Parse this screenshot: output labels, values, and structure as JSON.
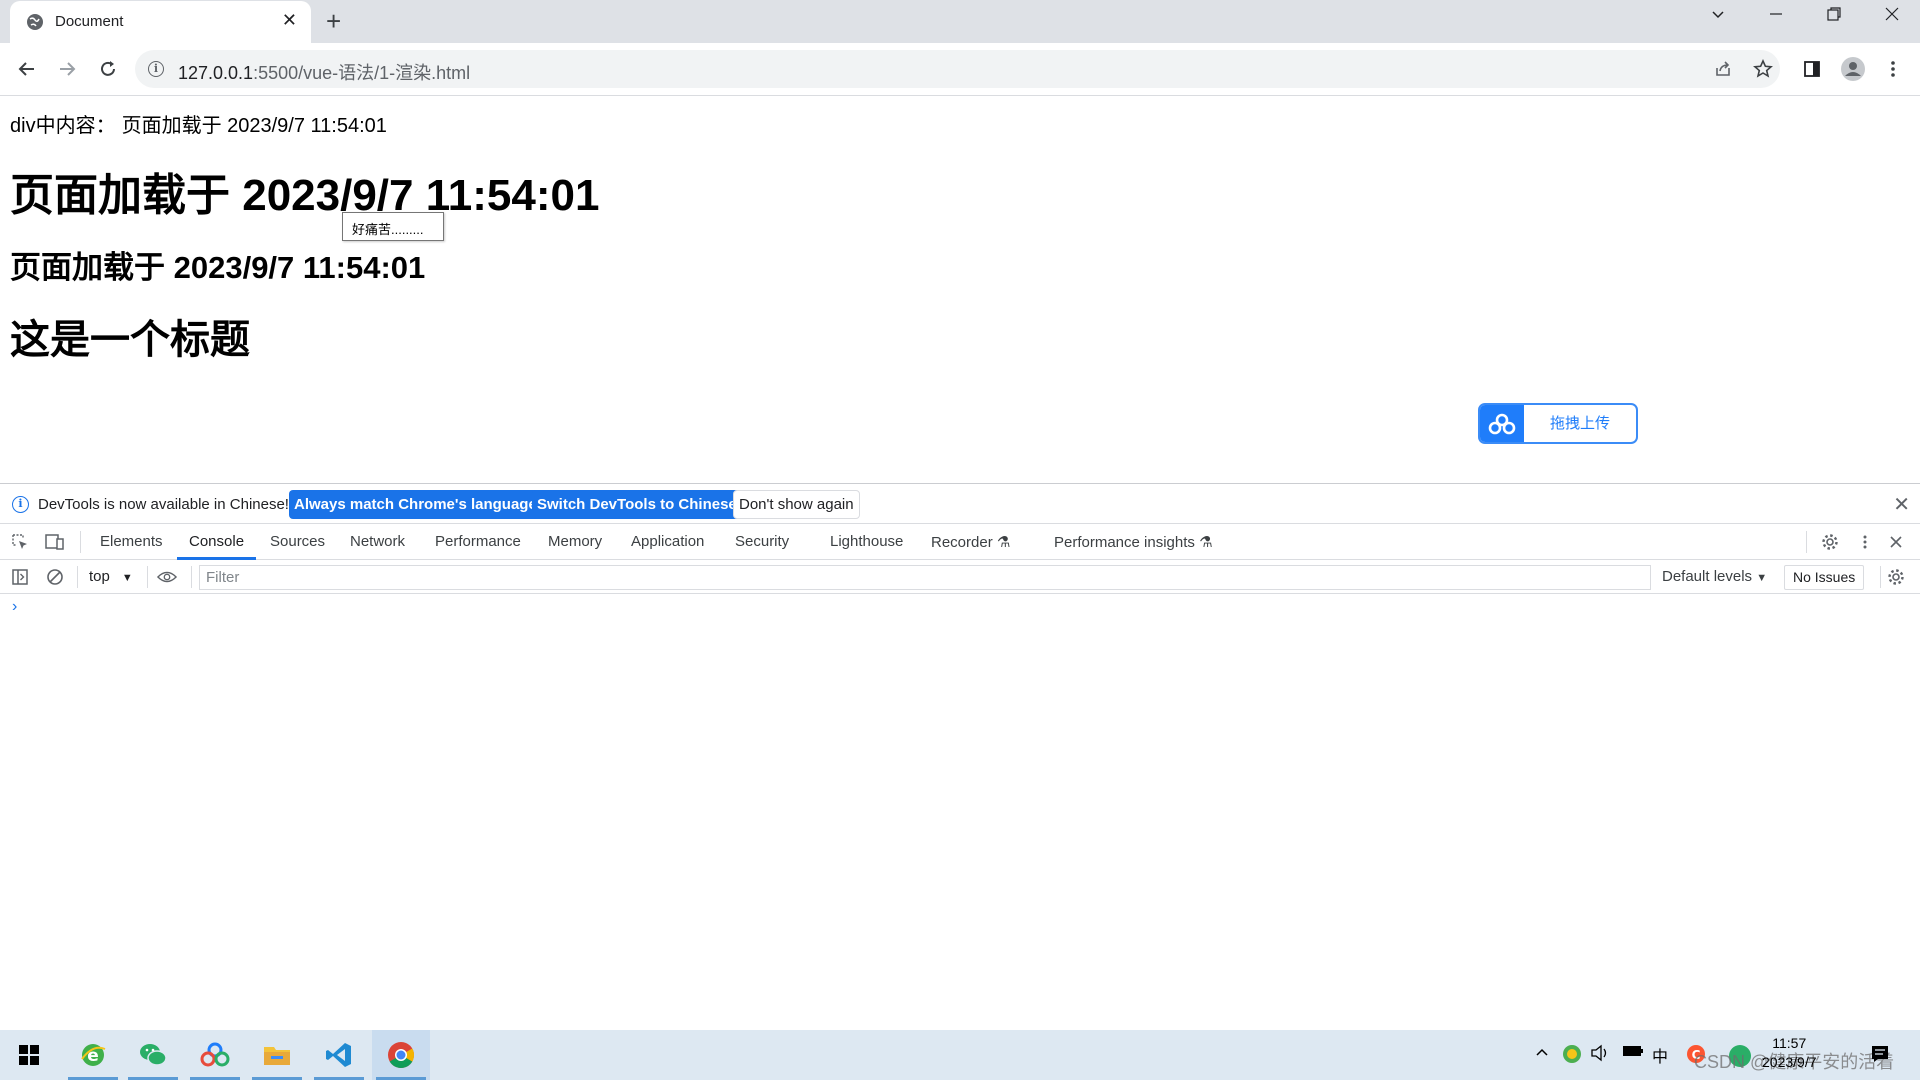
{
  "browser": {
    "tab_title": "Document",
    "url_host": "127.0.0.1",
    "url_rest": ":5500/vue-语法/1-渲染.html"
  },
  "page": {
    "div_label": "div中内容：",
    "div_value": "页面加载于 2023/9/7 11:54:01",
    "heading1": "页面加载于 2023/9/7 11:54:01",
    "heading2": "页面加载于 2023/9/7 11:54:01",
    "heading3": "这是一个标题",
    "tooltip": "好痛苦.........",
    "upload_button": "拖拽上传"
  },
  "devtools": {
    "infobar": {
      "message": "DevTools is now available in Chinese!",
      "btn_match": "Always match Chrome's language",
      "btn_switch": "Switch DevTools to Chinese",
      "btn_dismiss": "Don't show again"
    },
    "tabs": [
      "Elements",
      "Console",
      "Sources",
      "Network",
      "Performance",
      "Memory",
      "Application",
      "Security",
      "Lighthouse",
      "Recorder",
      "Performance insights"
    ],
    "active_tab": "Console",
    "console": {
      "context": "top",
      "filter_placeholder": "Filter",
      "levels": "Default levels",
      "issues": "No Issues",
      "prompt": "›"
    }
  },
  "taskbar": {
    "time": "11:57",
    "date": "2023/9/7",
    "ime": "中",
    "watermark": "CSDN @健康平安的活着"
  },
  "colors": {
    "accent": "#1a73e8",
    "upload_blue": "#1f7dfa",
    "titlebar": "#dee1e6",
    "taskbar": "#dde8f2"
  }
}
